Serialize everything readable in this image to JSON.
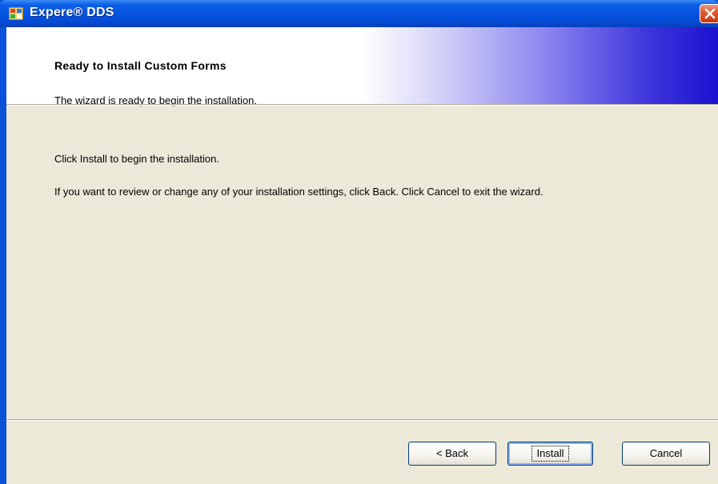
{
  "window": {
    "title": "Expere® DDS"
  },
  "header": {
    "title": "Ready to Install Custom Forms",
    "subtitle": "The wizard is ready to begin the installation."
  },
  "body": {
    "line1": "Click Install to begin the installation.",
    "line2": "If you want to review or change any of your installation settings, click Back. Click Cancel to exit the wizard."
  },
  "buttons": {
    "back_label": "< Back",
    "install_label": "Install",
    "cancel_label": "Cancel"
  },
  "colors": {
    "titlebar": "#0553e0",
    "dialog_bg": "#ece9d8",
    "header_gradient_end": "#1b12cf",
    "close_button": "#e05a33"
  },
  "icons": {
    "app": "installer-window-icon",
    "close": "close-icon"
  }
}
